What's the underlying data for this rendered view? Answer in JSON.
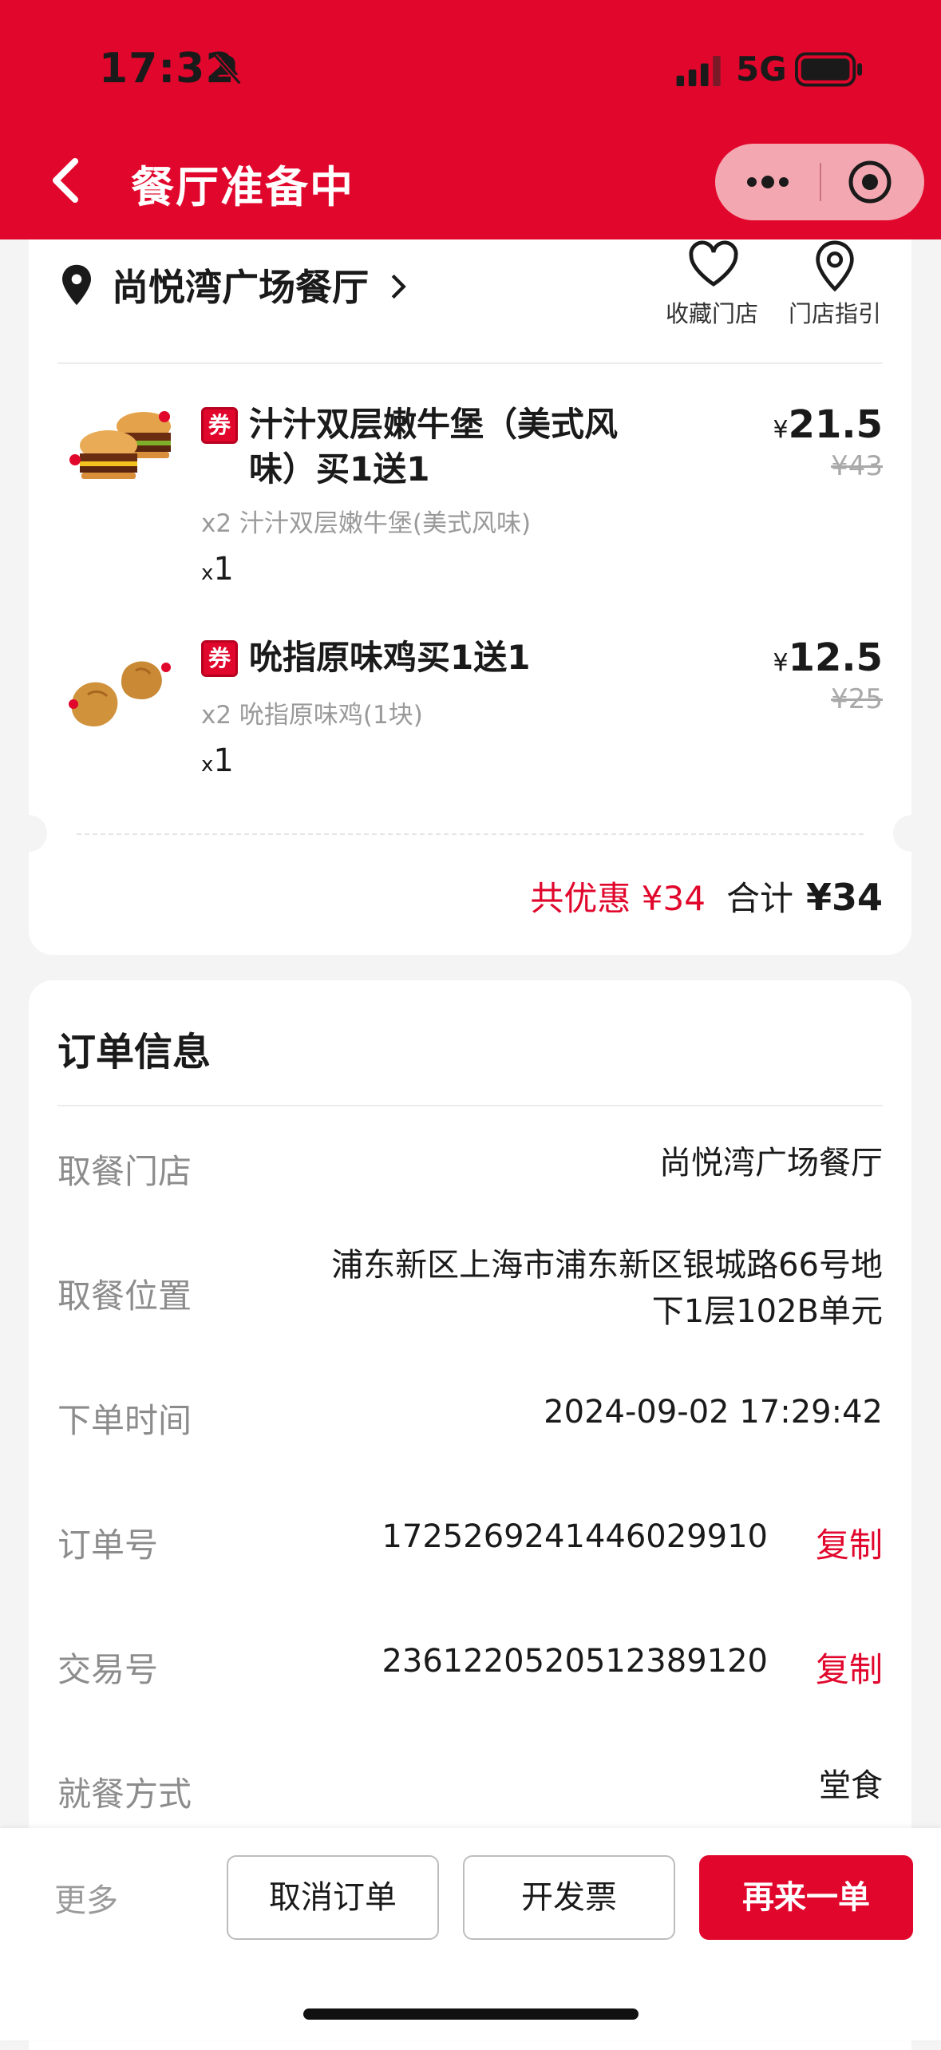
{
  "status_bar": {
    "time": "17:32",
    "network": "5G"
  },
  "nav": {
    "title": "餐厅准备中"
  },
  "store": {
    "name": "尚悦湾广场餐厅",
    "favorite_label": "收藏门店",
    "guide_label": "门店指引"
  },
  "items": [
    {
      "coupon": "券",
      "name_line1": "汁汁双层嫩牛堡（美式风",
      "name_line2": "味）买1送1",
      "detail": "x2 汁汁双层嫩牛堡(美式风味)",
      "qty_prefix": "x",
      "qty": "1",
      "price_symbol": "¥",
      "price": "21.5",
      "original_price": "¥43"
    },
    {
      "coupon": "券",
      "name_line1": "吮指原味鸡买1送1",
      "detail": "x2 吮指原味鸡(1块)",
      "qty_prefix": "x",
      "qty": "1",
      "price_symbol": "¥",
      "price": "12.5",
      "original_price": "¥25"
    }
  ],
  "summary": {
    "discount_text": "共优惠 ¥34",
    "total_label": "合计",
    "total": "¥34"
  },
  "order_info": {
    "title": "订单信息",
    "rows": [
      {
        "label": "取餐门店",
        "value": "尚悦湾广场餐厅"
      },
      {
        "label": "取餐位置",
        "value_line1": "浦东新区上海市浦东新区银城路66号地",
        "value_line2": "下1层102B单元"
      },
      {
        "label": "下单时间",
        "value": "2024-09-02 17:29:42"
      },
      {
        "label": "订单号",
        "value": "1725269241446029910",
        "action": "复制"
      },
      {
        "label": "交易号",
        "value": "2361220520512389120",
        "action": "复制"
      },
      {
        "label": "就餐方式",
        "value": "堂食"
      }
    ]
  },
  "bottom_bar": {
    "more": "更多",
    "cancel": "取消订单",
    "invoice": "开发票",
    "reorder": "再来一单"
  },
  "colors": {
    "brand_red": "#e1062c",
    "muted_text": "#8c8c8c"
  }
}
